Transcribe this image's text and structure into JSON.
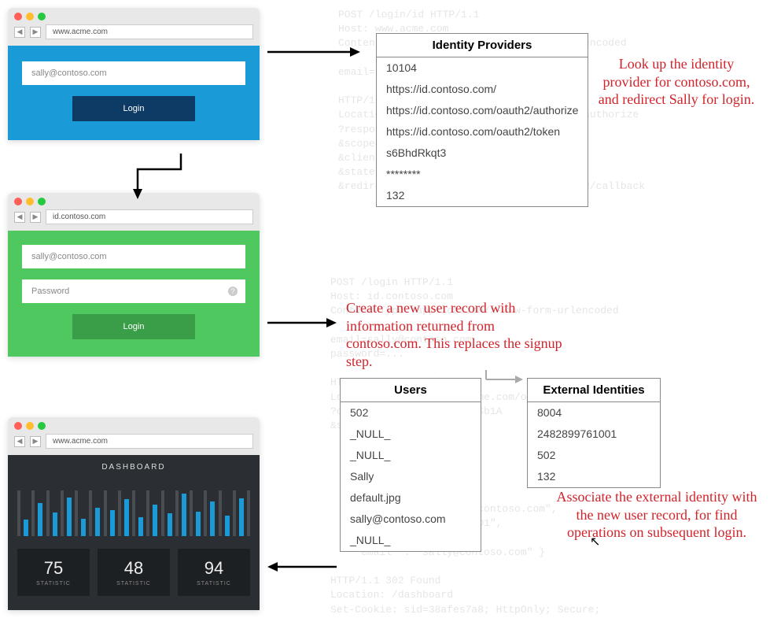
{
  "browsers": {
    "b1": {
      "url": "www.acme.com",
      "email_placeholder": "sally@contoso.com",
      "login_label": "Login"
    },
    "b2": {
      "url": "id.contoso.com",
      "email_placeholder": "sally@contoso.com",
      "password_placeholder": "Password",
      "login_label": "Login"
    },
    "b3": {
      "url": "www.acme.com",
      "dash_title": "DASHBOARD",
      "stats": [
        {
          "value": "75",
          "label": "STATISTIC"
        },
        {
          "value": "48",
          "label": "STATISTIC"
        },
        {
          "value": "94",
          "label": "STATISTIC"
        }
      ]
    }
  },
  "tables": {
    "idp": {
      "title": "Identity Providers",
      "rows": [
        "10104",
        "https://id.contoso.com/",
        "https://id.contoso.com/oauth2/authorize",
        "https://id.contoso.com/oauth2/token",
        "s6BhdRkqt3",
        "********",
        "132"
      ]
    },
    "users": {
      "title": "Users",
      "rows": [
        "502",
        "_NULL_",
        "_NULL_",
        "Sally",
        "default.jpg",
        "sally@contoso.com",
        "_NULL_"
      ]
    },
    "extid": {
      "title": "External Identities",
      "rows": [
        "8004",
        "2482899761001",
        "502",
        "132"
      ]
    }
  },
  "annotations": {
    "a1": "Look up the identity provider for contoso.com, and redirect Sally for login.",
    "a2": "Create a new user record with information returned from contoso.com.  This replaces the signup step.",
    "a3": "Associate the external identity with the new user record, for find operations on subsequent login."
  },
  "bgcode": {
    "c1": "POST /login/id HTTP/1.1\nHost: www.acme.com\nContent-Type: application/x-www-form-urlencoded\n\nemail=sally@contoso.com\n\nHTTP/1.1 302 Found\nLocation: https://id.contoso.com/oauth2/authorize\n?response_type=code\n&scope=openid profile email\n&client_id=s6BhdRkqt3\n&state=af0ifjsldkj\n&redirect_uri=https://www.acme.com/oauth2/callback",
    "c2": "POST /login HTTP/1.1\nHost: id.contoso.com\nContent-Type: application/x-www-form-urlencoded\n\nemail=sally@contoso.com\npassword=...\n\nHTTP/1.1 302 Found\nLocation: https://www.acme.com/oauth2/callback\n?code=Sp1x1OBeZQQYbYS6WxSb1A\n&state=af0ifjsldkj",
    "c3": "  id_token =\n  { \"iss\" : \"https://id.contoso.com\",\n    \"sub\" : \"2482899761001\",\n    \"name\" : \"Sally\",\n    \"email\" : \"sally@contoso.com\" }\n\nHTTP/1.1 302 Found\nLocation: /dashboard\nSet-Cookie: sid=38afes7a8; HttpOnly; Secure;"
  },
  "chart_data": {
    "type": "bar",
    "title": "DASHBOARD",
    "values": [
      35,
      70,
      50,
      82,
      36,
      60,
      55,
      78,
      40,
      66,
      48,
      90,
      52,
      74,
      44,
      80
    ]
  }
}
